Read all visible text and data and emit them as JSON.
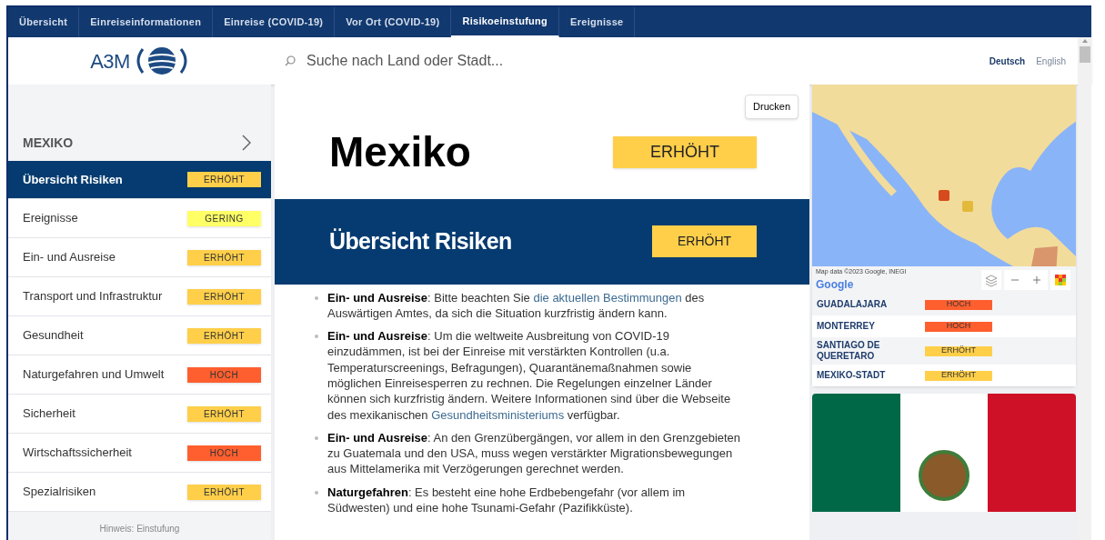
{
  "tabs": [
    {
      "label": "Übersicht",
      "selected": false
    },
    {
      "label": "Einreiseinformationen",
      "selected": false
    },
    {
      "label": "Einreise (COVID-19)",
      "selected": false
    },
    {
      "label": "Vor Ort (COVID-19)",
      "selected": false
    },
    {
      "label": "Risikoeinstufung",
      "selected": true
    },
    {
      "label": "Ereignisse",
      "selected": false
    }
  ],
  "header": {
    "logo": "A3M",
    "search": {
      "placeholder": "Suche nach Land oder Stadt..."
    },
    "languages": [
      {
        "label": "Deutsch",
        "selected": true
      },
      {
        "label": "English",
        "selected": false
      }
    ]
  },
  "sidebar": {
    "title": "MEXIKO",
    "items": [
      {
        "label": "Übersicht Risiken",
        "selected": true,
        "rating": "ERHÖHT",
        "color": "#ffcf4a"
      },
      {
        "label": "Ereignisse",
        "selected": false,
        "rating": "GERING",
        "color": "#ffff66"
      },
      {
        "label": "Ein- und Ausreise",
        "selected": false,
        "rating": "ERHÖHT",
        "color": "#ffcf4a"
      },
      {
        "label": "Transport und Infrastruktur",
        "selected": false,
        "rating": "ERHÖHT",
        "color": "#ffcf4a"
      },
      {
        "label": "Gesundheit",
        "selected": false,
        "rating": "ERHÖHT",
        "color": "#ffcf4a"
      },
      {
        "label": "Naturgefahren und Umwelt",
        "selected": false,
        "rating": "HOCH",
        "color": "#ff5f2e"
      },
      {
        "label": "Sicherheit",
        "selected": false,
        "rating": "ERHÖHT",
        "color": "#ffcf4a"
      },
      {
        "label": "Wirtschaftssicherheit",
        "selected": false,
        "rating": "HOCH",
        "color": "#ff5f2e"
      },
      {
        "label": "Spezialrisiken",
        "selected": false,
        "rating": "ERHÖHT",
        "color": "#ffcf4a"
      }
    ],
    "note": "Hinweis: Einstufung"
  },
  "main": {
    "print_button": "Drucken",
    "country": "Mexiko",
    "rating": "ERHÖHT",
    "section_title": "Übersicht Risiken",
    "section_rating": "ERHÖHT",
    "bullets": [
      [
        {
          "kind": "bold",
          "text": "Ein- und Ausreise"
        },
        {
          "kind": "text",
          "text": ": Bitte beachten Sie "
        },
        {
          "kind": "link",
          "text": "die aktuellen Bestimmungen"
        },
        {
          "kind": "text",
          "text": " des Auswärtigen Amtes, da sich die Situation kurzfristig ändern kann."
        }
      ],
      [
        {
          "kind": "bold",
          "text": "Ein- und Ausreise"
        },
        {
          "kind": "text",
          "text": ":  Um die weltweite Ausbreitung von COVID-19 einzudämmen, ist bei der Einreise mit verstärkten Kontrollen (u.a. Temperaturscreenings, Befragungen), Quarantänemaßnahmen sowie möglichen Einreisesperren zu rechnen. Die Regelungen einzelner Länder können sich kurzfristig ändern. Weitere Informationen sind über die Webseite des mexikanischen "
        },
        {
          "kind": "link",
          "text": "Gesundheitsministeriums"
        },
        {
          "kind": "text",
          "text": " verfügbar."
        }
      ],
      [
        {
          "kind": "bold",
          "text": "Ein- und Ausreise"
        },
        {
          "kind": "text",
          "text": ": An den Grenzübergängen, vor allem in den Grenzgebieten zu Guatemala und den USA, muss wegen verstärkter Migrationsbewegungen aus Mittelamerika mit Verzögerungen gerechnet werden."
        }
      ],
      [
        {
          "kind": "bold",
          "text": "Naturgefahren"
        },
        {
          "kind": "text",
          "text": ": Es besteht eine hohe Erdbebengefahr (vor allem im Südwesten) und eine hohe Tsunami-Gefahr (Pazifikküste)."
        }
      ]
    ]
  },
  "map": {
    "attribution": "Map data ©2023 Google, INEGI",
    "brand": "Google"
  },
  "cities": [
    {
      "name": "GUADALAJARA",
      "rating": "HOCH",
      "color": "#ff5f2e"
    },
    {
      "name": "MONTERREY",
      "rating": "HOCH",
      "color": "#ff5f2e"
    },
    {
      "name": "SANTIAGO DE QUERETARO",
      "rating": "ERHÖHT",
      "color": "#ffcf4a"
    },
    {
      "name": "MEXIKO-STADT",
      "rating": "ERHÖHT",
      "color": "#ffcf4a"
    }
  ]
}
